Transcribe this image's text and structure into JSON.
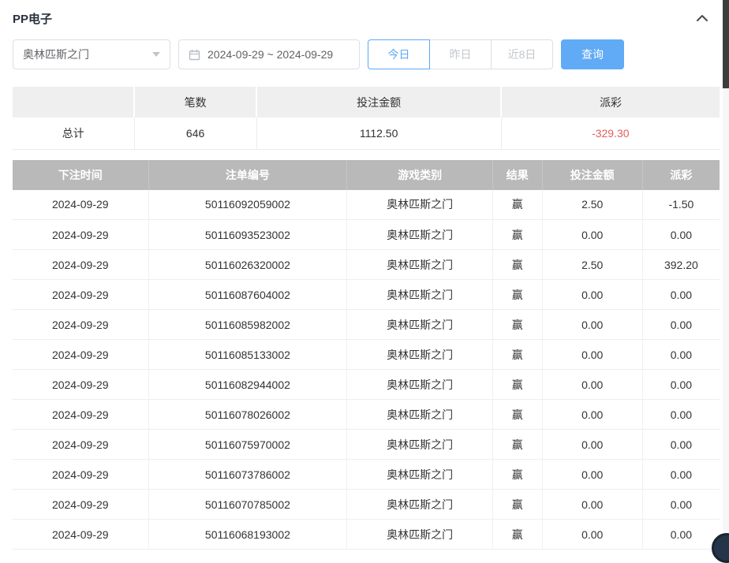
{
  "header": {
    "title": "PP电子"
  },
  "filters": {
    "game_select": {
      "value": "奥林匹斯之门"
    },
    "date_range": {
      "value": "2024-09-29 ~ 2024-09-29"
    },
    "quick_buttons": [
      {
        "label": "今日",
        "active": true
      },
      {
        "label": "昨日",
        "active": false
      },
      {
        "label": "近8日",
        "active": false
      }
    ],
    "search_label": "查询"
  },
  "summary": {
    "headers": [
      "",
      "笔数",
      "投注金额",
      "派彩"
    ],
    "row_label": "总计",
    "count": "646",
    "bet_amount": "1112.50",
    "payout": "-329.30"
  },
  "table": {
    "headers": [
      "下注时间",
      "注单编号",
      "游戏类别",
      "结果",
      "投注金额",
      "派彩"
    ],
    "rows": [
      [
        "2024-09-29",
        "50116092059002",
        "奥林匹斯之门",
        "赢",
        "2.50",
        "-1.50"
      ],
      [
        "2024-09-29",
        "50116093523002",
        "奥林匹斯之门",
        "赢",
        "0.00",
        "0.00"
      ],
      [
        "2024-09-29",
        "50116026320002",
        "奥林匹斯之门",
        "赢",
        "2.50",
        "392.20"
      ],
      [
        "2024-09-29",
        "50116087604002",
        "奥林匹斯之门",
        "赢",
        "0.00",
        "0.00"
      ],
      [
        "2024-09-29",
        "50116085982002",
        "奥林匹斯之门",
        "赢",
        "0.00",
        "0.00"
      ],
      [
        "2024-09-29",
        "50116085133002",
        "奥林匹斯之门",
        "赢",
        "0.00",
        "0.00"
      ],
      [
        "2024-09-29",
        "50116082944002",
        "奥林匹斯之门",
        "赢",
        "0.00",
        "0.00"
      ],
      [
        "2024-09-29",
        "50116078026002",
        "奥林匹斯之门",
        "赢",
        "0.00",
        "0.00"
      ],
      [
        "2024-09-29",
        "50116075970002",
        "奥林匹斯之门",
        "赢",
        "0.00",
        "0.00"
      ],
      [
        "2024-09-29",
        "50116073786002",
        "奥林匹斯之门",
        "赢",
        "0.00",
        "0.00"
      ],
      [
        "2024-09-29",
        "50116070785002",
        "奥林匹斯之门",
        "赢",
        "0.00",
        "0.00"
      ],
      [
        "2024-09-29",
        "50116068193002",
        "奥林匹斯之门",
        "赢",
        "0.00",
        "0.00"
      ]
    ]
  },
  "colors": {
    "accent": "#5da8f5",
    "negative": "#e25d5d",
    "table_header_bg": "#b9b9b9"
  }
}
